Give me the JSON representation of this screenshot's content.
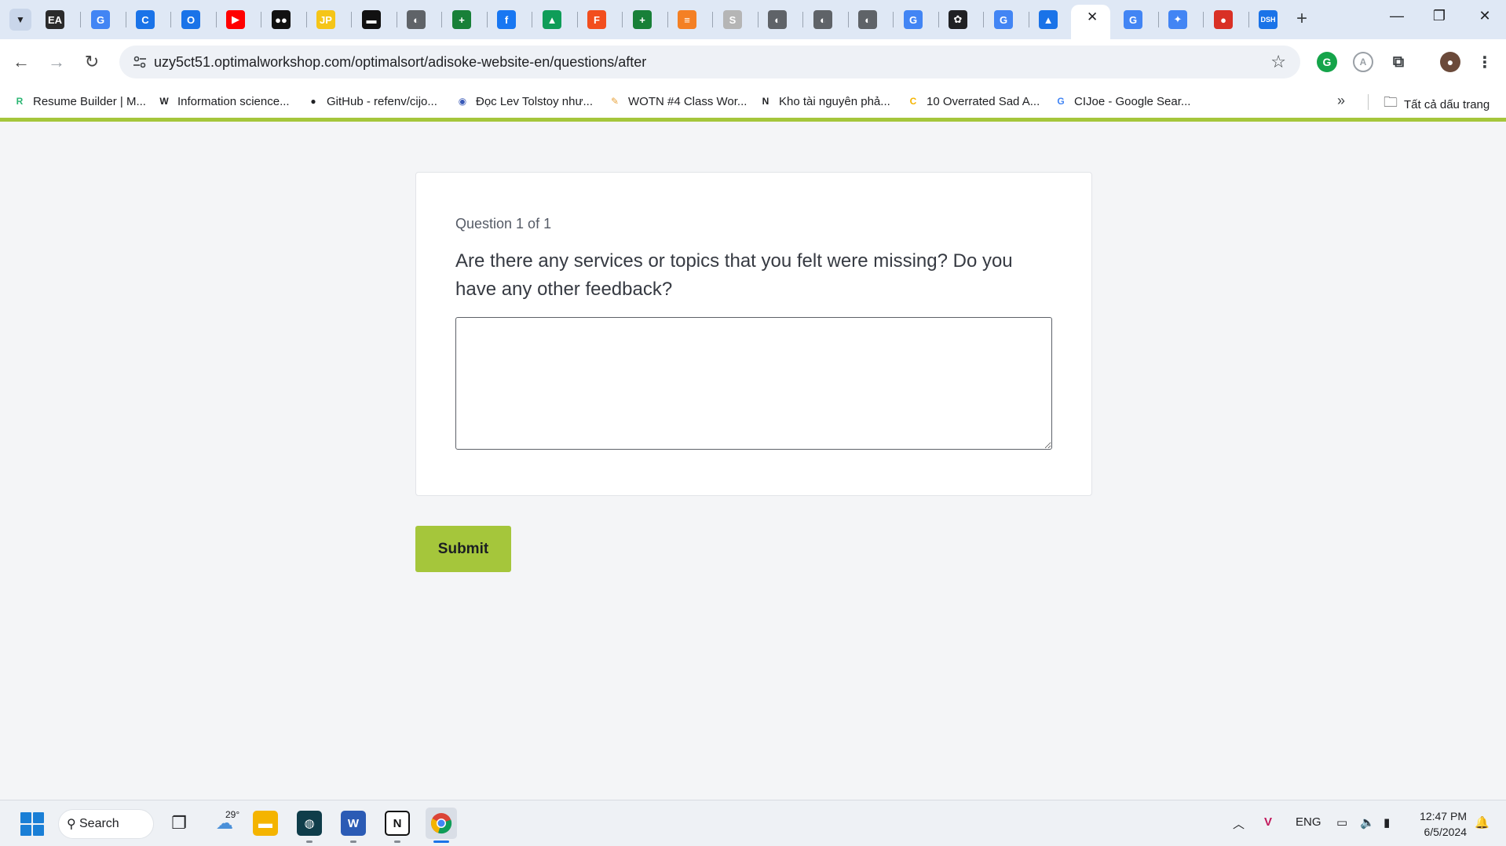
{
  "browser": {
    "url": "uzy5ct51.optimalworkshop.com/optimalsort/adisoke-website-en/questions/after",
    "tab_icons": [
      {
        "icon": "ea-icon",
        "glyph": "EA",
        "color": "#2b2b2b"
      },
      {
        "icon": "google-icon",
        "glyph": "G",
        "color": "#4285f4"
      },
      {
        "icon": "grammarly-c-icon",
        "glyph": "C",
        "color": "#1a73e8"
      },
      {
        "icon": "opera-icon",
        "glyph": "O",
        "color": "#1a73e8"
      },
      {
        "icon": "youtube-icon",
        "glyph": "▶",
        "color": "#ff0000"
      },
      {
        "icon": "medium-icon",
        "glyph": "●●",
        "color": "#111111"
      },
      {
        "icon": "jp-icon",
        "glyph": "JP",
        "color": "#f5c518"
      },
      {
        "icon": "dark-site-icon",
        "glyph": "▬",
        "color": "#111111"
      },
      {
        "icon": "globe-icon",
        "glyph": "◐",
        "color": "#5f6368"
      },
      {
        "icon": "sheets-icon",
        "glyph": "+",
        "color": "#188038"
      },
      {
        "icon": "facebook-icon",
        "glyph": "f",
        "color": "#1877f2"
      },
      {
        "icon": "drive-icon",
        "glyph": "▲",
        "color": "#0f9d58"
      },
      {
        "icon": "figma-icon",
        "glyph": "F",
        "color": "#f24e1e"
      },
      {
        "icon": "sheets-icon",
        "glyph": "+",
        "color": "#188038"
      },
      {
        "icon": "stackoverflow-icon",
        "glyph": "≡",
        "color": "#f48024"
      },
      {
        "icon": "document-icon",
        "glyph": "S",
        "color": "#b5b5b5"
      },
      {
        "icon": "globe-icon",
        "glyph": "◐",
        "color": "#5f6368"
      },
      {
        "icon": "globe-icon",
        "glyph": "◐",
        "color": "#5f6368"
      },
      {
        "icon": "globe-icon",
        "glyph": "◐",
        "color": "#5f6368"
      },
      {
        "icon": "google-icon",
        "glyph": "G",
        "color": "#4285f4"
      },
      {
        "icon": "chatgpt-icon",
        "glyph": "✿",
        "color": "#202124"
      },
      {
        "icon": "google-icon",
        "glyph": "G",
        "color": "#4285f4"
      },
      {
        "icon": "vercel-icon",
        "glyph": "▲",
        "color": "#1a73e8"
      },
      {
        "icon": "google-icon",
        "glyph": "G",
        "color": "#4285f4"
      },
      {
        "icon": "gemini-icon",
        "glyph": "✦",
        "color": "#4285f4"
      },
      {
        "icon": "red-app-icon",
        "glyph": "●",
        "color": "#d93025"
      },
      {
        "icon": "dsh-icon",
        "glyph": "DSH",
        "color": "#1a73e8"
      }
    ],
    "bookmarks": [
      {
        "label": "Resume Builder | M...",
        "icon": "resume-builder-icon",
        "glyph": "R",
        "color": "#2bb673"
      },
      {
        "label": "Information science...",
        "icon": "wikipedia-icon",
        "glyph": "W",
        "color": "#202124"
      },
      {
        "label": "GitHub - refenv/cijo...",
        "icon": "github-icon",
        "glyph": "●",
        "color": "#202124"
      },
      {
        "label": "Đọc Lev Tolstoy như...",
        "icon": "globe-icon",
        "glyph": "◉",
        "color": "#3a5ab8"
      },
      {
        "label": "WOTN #4 Class Wor...",
        "icon": "pencil-icon",
        "glyph": "✎",
        "color": "#e8a33d"
      },
      {
        "label": "Kho tài nguyên phả...",
        "icon": "notion-icon",
        "glyph": "N",
        "color": "#202124"
      },
      {
        "label": "10 Overrated Sad A...",
        "icon": "c-site-icon",
        "glyph": "C",
        "color": "#f5b400"
      },
      {
        "label": "CIJoe - Google Sear...",
        "icon": "google-icon",
        "glyph": "G",
        "color": "#4285f4"
      }
    ],
    "all_bookmarks_label": "Tất cả dấu trang"
  },
  "page": {
    "question_count": "Question 1 of 1",
    "question_text": "Are there any services or topics that you felt were missing? Do you have any other feedback?",
    "answer_value": "",
    "submit_label": "Submit",
    "accent_color": "#a5c63b"
  },
  "taskbar": {
    "search_label": "Search",
    "weather_temp": "29°",
    "language": "ENG",
    "time": "12:47 PM",
    "date": "6/5/2024"
  }
}
